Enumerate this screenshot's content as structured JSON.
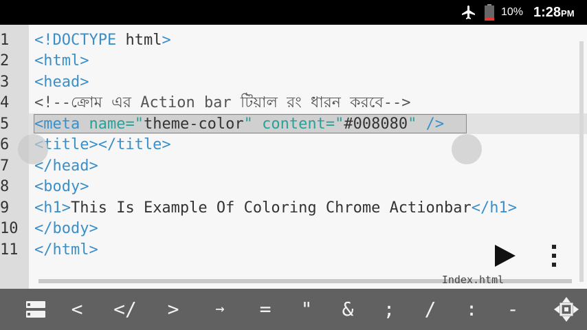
{
  "status": {
    "battery_percent": "10%",
    "time": "1:28",
    "ampm": "PM"
  },
  "editor": {
    "line_numbers": [
      "1",
      "2",
      "3",
      "4",
      "5",
      "6",
      "7",
      "8",
      "9",
      "10",
      "11"
    ],
    "lines": {
      "l1": {
        "tag_open": "<!DOCTYPE",
        "text": " html",
        "tag_close": ">"
      },
      "l2": {
        "tag": "<html>"
      },
      "l3": {
        "tag": "<head>"
      },
      "l4": {
        "comment": "<!--ক্রোম এর Action bar টিয়াল রং ধারন করবে-->"
      },
      "l5": {
        "tag_open": "<meta",
        "attr1": " name=",
        "q1": "\"",
        "val1": "theme-color",
        "q2": "\"",
        "attr2": " content=",
        "q3": "\"",
        "val2": "#008080",
        "q4": "\"",
        "tag_close": " />"
      },
      "l6": {
        "tag": "<title></title>"
      },
      "l7": {
        "tag": "</head>"
      },
      "l8": {
        "tag": "<body>"
      },
      "l9": {
        "tag_open": "<h1>",
        "text": "This Is Example Of Coloring Chrome Actionbar",
        "tag_close": "</h1>"
      },
      "l10": {
        "tag": "</body>"
      },
      "l11": {
        "tag": "</html>"
      }
    },
    "filename": "Index.html"
  },
  "toolbar": {
    "keys": [
      "<",
      "</",
      ">",
      "→",
      "=",
      "\"",
      "&",
      ";",
      "/",
      ":",
      "-"
    ]
  },
  "colors": {
    "tag": "#3a8fc9",
    "attr": "#2aa198",
    "toolbar_bg": "#616161"
  }
}
